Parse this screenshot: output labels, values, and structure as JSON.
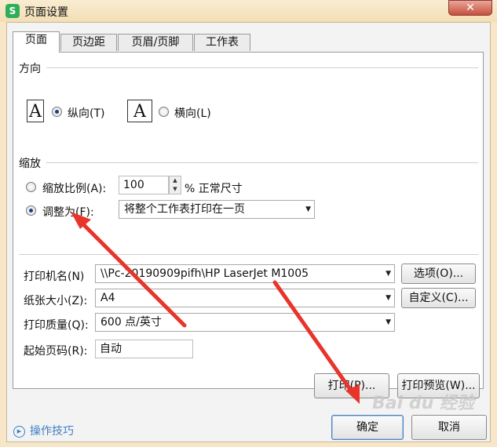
{
  "window": {
    "title": "页面设置",
    "close_glyph": "✕",
    "app_icon": "S"
  },
  "tabs": [
    {
      "label": "页面",
      "active": true
    },
    {
      "label": "页边距"
    },
    {
      "label": "页眉/页脚"
    },
    {
      "label": "工作表"
    }
  ],
  "orientation": {
    "title": "方向",
    "portrait": "纵向(T)",
    "landscape": "横向(L)",
    "selected": "portrait",
    "page_glyph": "A"
  },
  "scaling": {
    "title": "缩放",
    "ratio_label": "缩放比例(A):",
    "ratio_value": "100",
    "ratio_suffix": "% 正常尺寸",
    "fit_label": "调整为(F):",
    "fit_value": "将整个工作表打印在一页",
    "selected": "fit"
  },
  "printer": {
    "name_label": "打印机名(N)",
    "name_value": "\\\\Pc-20190909pifh\\HP LaserJet M1005",
    "options_button": "选项(O)...",
    "paper_label": "纸张大小(Z):",
    "paper_value": "A4",
    "custom_button": "自定义(C)...",
    "quality_label": "打印质量(Q):",
    "quality_value": "600 点/英寸",
    "start_label": "起始页码(R):",
    "start_value": "自动"
  },
  "actions": {
    "print": "打印(P)...",
    "preview": "打印预览(W)...",
    "ok": "确定",
    "cancel": "取消"
  },
  "tips": {
    "label": "操作技巧",
    "icon": "▶"
  },
  "overlay": {
    "watermark": "Bai du 经验",
    "arrow_color": "#e8342b"
  }
}
